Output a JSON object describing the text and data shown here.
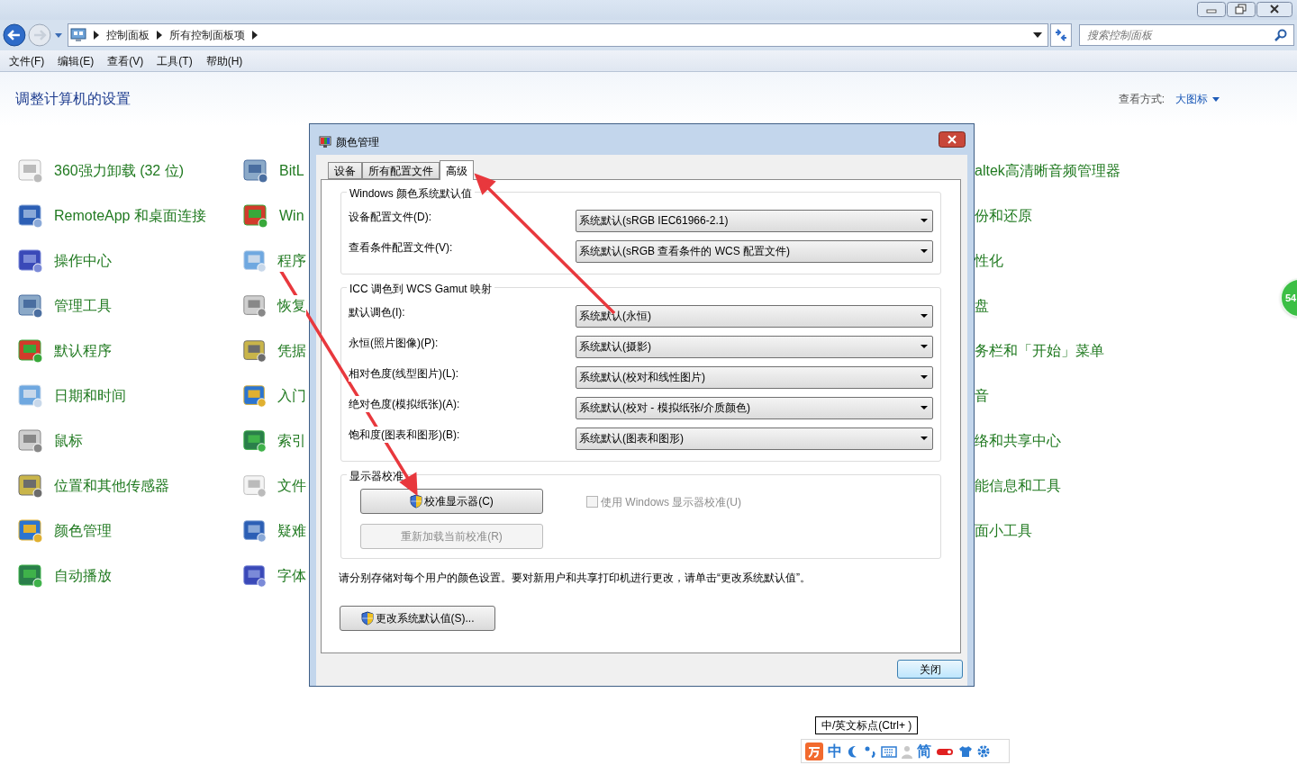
{
  "address_bar": {
    "breadcrumbs": [
      "控制面板",
      "所有控制面板项"
    ]
  },
  "search": {
    "placeholder": "搜索控制面板"
  },
  "menu_bar": [
    "文件(F)",
    "编辑(E)",
    "查看(V)",
    "工具(T)",
    "帮助(H)"
  ],
  "heading": "调整计算机的设置",
  "view_by": {
    "label": "查看方式:",
    "value": "大图标"
  },
  "items": {
    "column_1": [
      "360强力卸载 (32 位)",
      "RemoteApp 和桌面连接",
      "操作中心",
      "管理工具",
      "默认程序",
      "日期和时间",
      "鼠标",
      "位置和其他传感器",
      "颜色管理",
      "自动播放"
    ],
    "column_2": [
      "BitL",
      "Win",
      "程序",
      "恢复",
      "凭据",
      "入门",
      "索引",
      "文件",
      "疑难",
      "字体"
    ],
    "column_3": [
      "altek高清晰音频管理器",
      "份和还原",
      "性化",
      "盘",
      "务栏和「开始」菜单",
      "音",
      "络和共享中心",
      "能信息和工具",
      "面小工具"
    ]
  },
  "badge": "54",
  "dialog": {
    "title": "颜色管理",
    "tabs": [
      {
        "label": "设备",
        "selected": false
      },
      {
        "label": "所有配置文件",
        "selected": false
      },
      {
        "label": "高级",
        "selected": true
      }
    ],
    "groups": [
      {
        "title": "Windows 颜色系统默认值",
        "rows": [
          {
            "label": "设备配置文件(D):",
            "value": "系统默认(sRGB IEC61966-2.1)"
          },
          {
            "label": "查看条件配置文件(V):",
            "value": "系统默认(sRGB 查看条件的 WCS 配置文件)"
          }
        ]
      },
      {
        "title": "ICC 调色到 WCS Gamut 映射",
        "rows": [
          {
            "label": "默认调色(I):",
            "value": "系统默认(永恒)"
          },
          {
            "label": "永恒(照片图像)(P):",
            "value": "系统默认(摄影)"
          },
          {
            "label": "相对色度(线型图片)(L):",
            "value": "系统默认(校对和线性图片)"
          },
          {
            "label": "绝对色度(模拟纸张)(A):",
            "value": "系统默认(校对 - 模拟纸张/介质颜色)"
          },
          {
            "label": "饱和度(图表和图形)(B):",
            "value": "系统默认(图表和图形)"
          }
        ]
      }
    ],
    "calibration": {
      "title": "显示器校准",
      "buttons": [
        {
          "label": "校准显示器(C)",
          "disabled": false,
          "shield": true
        },
        {
          "label": "重新加载当前校准(R)",
          "disabled": true,
          "shield": false
        }
      ],
      "checkbox": {
        "label": "使用 Windows 显示器校准(U)",
        "checked": false,
        "disabled": true
      }
    },
    "note": "请分别存储对每个用户的颜色设置。要对新用户和共享打印机进行更改，请单击“更改系统默认值”。",
    "defaults_button": "更改系统默认值(S)...",
    "close_button": "关闭"
  },
  "ime": {
    "tooltip": "中/英文标点(Ctrl+ )",
    "mode": "中",
    "script": "简"
  }
}
